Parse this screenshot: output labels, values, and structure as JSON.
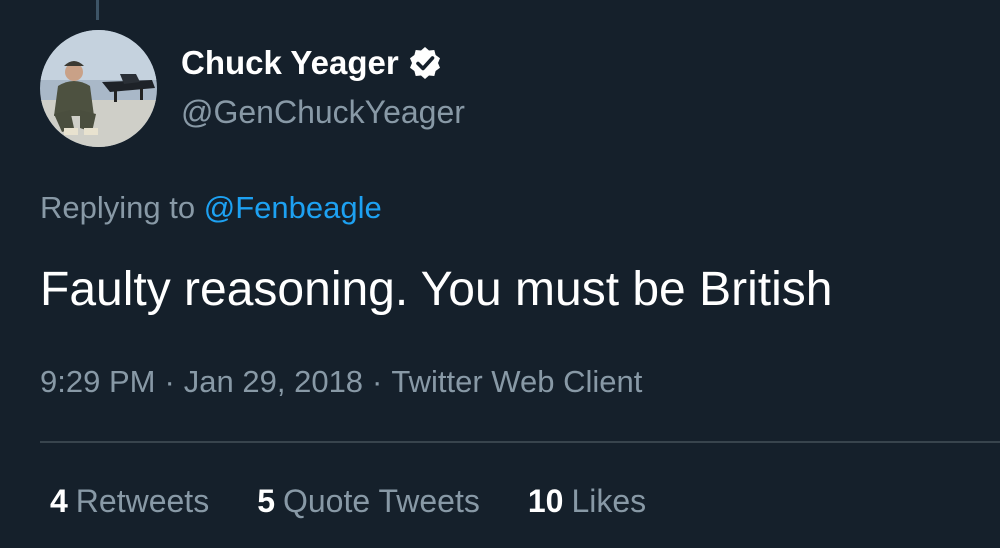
{
  "tweet": {
    "author": {
      "display_name": "Chuck Yeager",
      "handle": "@GenChuckYeager",
      "verified": true
    },
    "reply": {
      "prefix": "Replying to",
      "mention": "@Fenbeagle"
    },
    "text": "Faulty reasoning. You must be British",
    "meta": {
      "time": "9:29 PM",
      "separator": "·",
      "date": "Jan 29, 2018",
      "source": "Twitter Web Client"
    },
    "stats": {
      "retweets": {
        "count": "4",
        "label": "Retweets"
      },
      "quote_tweets": {
        "count": "5",
        "label": "Quote Tweets"
      },
      "likes": {
        "count": "10",
        "label": "Likes"
      }
    }
  },
  "colors": {
    "background": "#15202b",
    "primary_text": "#ffffff",
    "secondary_text": "#8899a6",
    "link": "#1da1f2",
    "divider": "#38444d"
  }
}
